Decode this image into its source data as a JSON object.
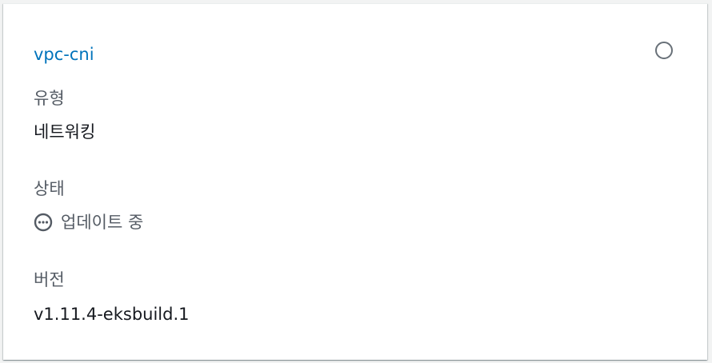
{
  "card": {
    "addon_name": "vpc-cni",
    "type_label": "유형",
    "type_value": "네트워킹",
    "status_label": "상태",
    "status_value": "업데이트 중",
    "status_icon": "pending-icon",
    "version_label": "버전",
    "version_value": "v1.11.4-eksbuild.1"
  },
  "colors": {
    "link": "#0073bb",
    "label": "#545b64",
    "value": "#16191f",
    "radio_border": "#687078"
  }
}
